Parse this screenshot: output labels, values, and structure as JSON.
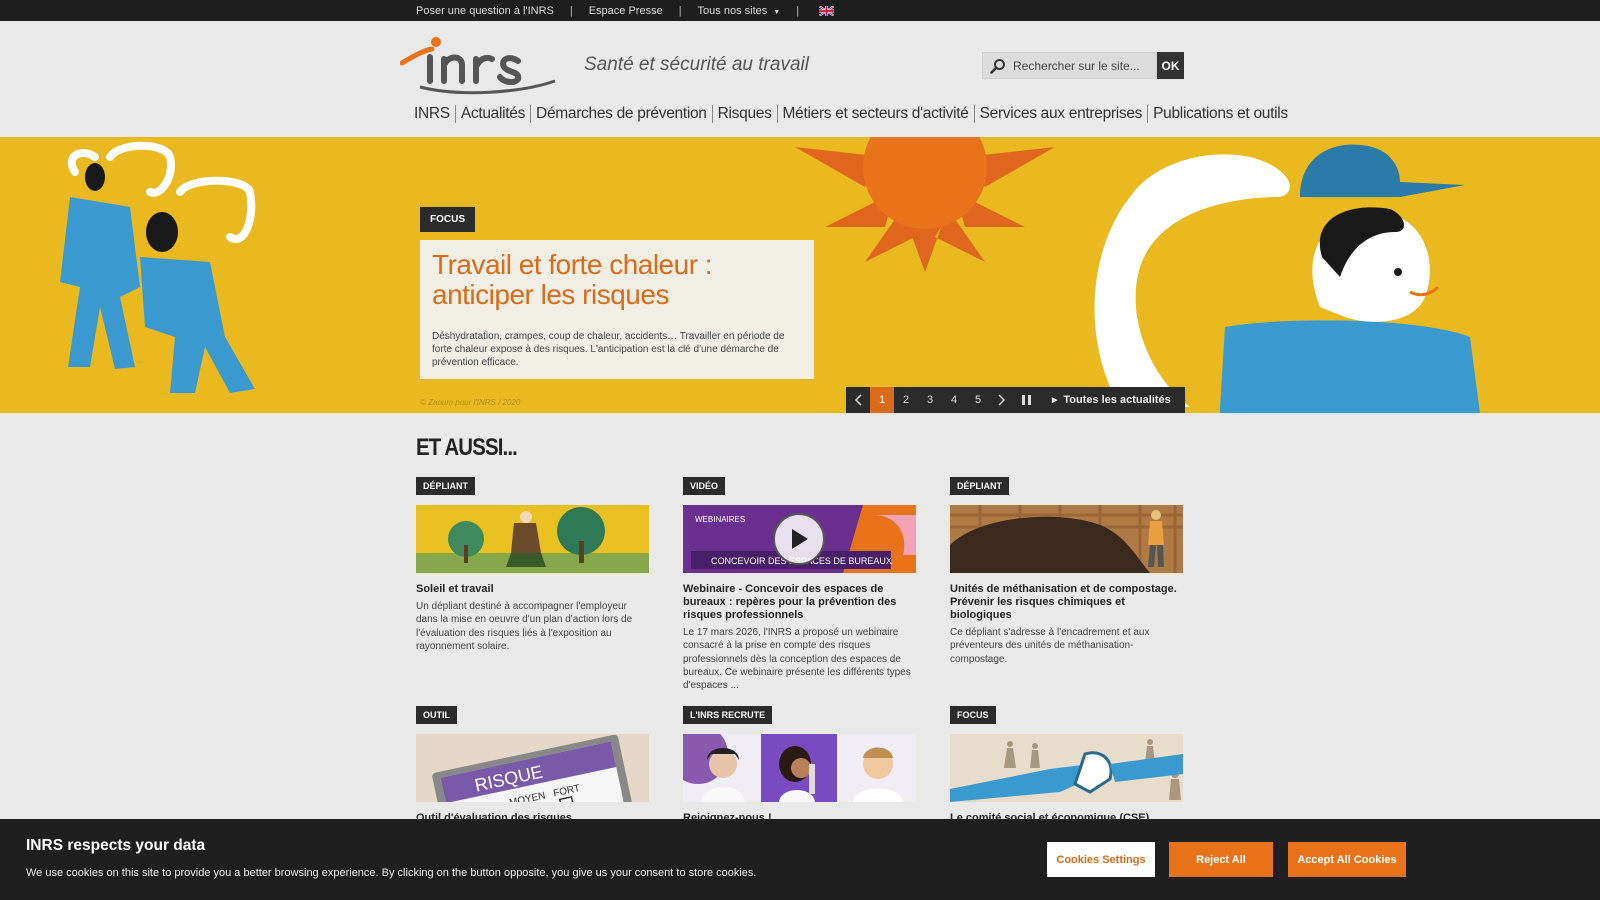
{
  "topbar": {
    "links": [
      "Poser une question à l'INRS",
      "Espace Presse",
      "Tous nos sites"
    ]
  },
  "header": {
    "logo_text": "inrs",
    "tagline": "Santé et sécurité au travail",
    "search_placeholder": "Rechercher sur le site...",
    "search_button": "OK",
    "nav": [
      "INRS",
      "Actualités",
      "Démarches de prévention",
      "Risques",
      "Métiers et secteurs d'activité",
      "Services aux entreprises",
      "Publications et outils"
    ]
  },
  "hero": {
    "tag": "FOCUS",
    "title": "Travail et forte chaleur : anticiper les risques",
    "text": "Déshydratation, crampes, coup de chaleur, accidents… Travailler en période de forte chaleur expose à des risques. L'anticipation est la clé d'une démarche de prévention efficace.",
    "credit": "© Zaoum pour l'INRS / 2020",
    "pages": [
      "1",
      "2",
      "3",
      "4",
      "5"
    ],
    "active_page": "1",
    "all_news": "Toutes les actualités"
  },
  "section": {
    "title": "ET AUSSI..."
  },
  "cards": [
    {
      "tag": "DÉPLIANT",
      "title": "Soleil et travail",
      "desc": "Un dépliant destiné à accompagner l'employeur dans la mise en oeuvre d'un plan d'action lors de l'évaluation des risques liés à l'exposition au rayonnement solaire."
    },
    {
      "tag": "VIDÉO",
      "title": "Webinaire - Concevoir des espaces de bureaux : repères pour la prévention des risques professionnels",
      "desc": "Le 17 mars 2026, l'INRS a proposé un webinaire consacré à la prise en compte des risques professionnels dès la conception des espaces de bureaux. Ce webinaire présente les différents types d'espaces ...",
      "thumb_text_1": "WEBINAIRES",
      "thumb_text_2": "CONCEVOIR DES ESPACES DE BUREAUX"
    },
    {
      "tag": "DÉPLIANT",
      "title": "Unités de méthanisation et de compostage. Prévenir les risques chimiques et biologiques",
      "desc": "Ce dépliant s'adresse à l'encadrement et aux préventeurs des unités de méthanisation-compostage."
    },
    {
      "tag": "OUTIL",
      "title": "Outil d'évaluation des risques",
      "desc": "",
      "thumb_text_1": "RISQUE",
      "thumb_text_2": "MOYEN",
      "thumb_text_3": "FORT"
    },
    {
      "tag": "L'INRS RECRUTE",
      "title": "Rejoignez-nous !",
      "desc": ""
    },
    {
      "tag": "FOCUS",
      "title": "Le comité social et économique (CSE)",
      "desc": ""
    }
  ],
  "cookie": {
    "title": "INRS respects your data",
    "text": "We use cookies on this site to provide you a better browsing experience. By clicking on the button opposite, you give us your consent to store cookies.",
    "settings": "Cookies Settings",
    "reject": "Reject All",
    "accept": "Accept All Cookies"
  },
  "colors": {
    "accent": "#d96b19",
    "hero_bg": "#e9b91f",
    "dark": "#2b2b2b",
    "figure_blue": "#3a9ad0"
  }
}
